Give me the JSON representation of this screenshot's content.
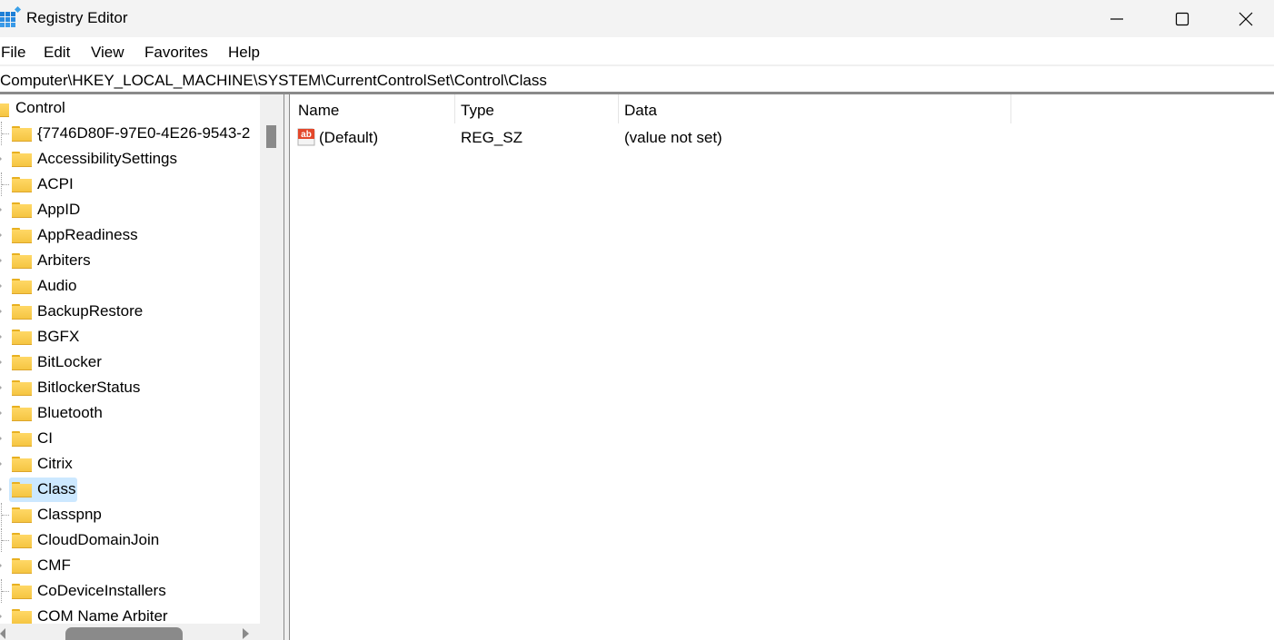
{
  "window": {
    "title": "Registry Editor",
    "controls": [
      "minimize",
      "maximize",
      "close"
    ]
  },
  "menu": {
    "items": [
      "File",
      "Edit",
      "View",
      "Favorites",
      "Help"
    ]
  },
  "address_bar": {
    "path": "Computer\\HKEY_LOCAL_MACHINE\\SYSTEM\\CurrentControlSet\\Control\\Class"
  },
  "tree": {
    "parent": "Control",
    "selected": "Class",
    "items": [
      {
        "label": "{7746D80F-97E0-4E26-9543-2",
        "expandable": false
      },
      {
        "label": "AccessibilitySettings",
        "expandable": true
      },
      {
        "label": "ACPI",
        "expandable": false
      },
      {
        "label": "AppID",
        "expandable": true
      },
      {
        "label": "AppReadiness",
        "expandable": true
      },
      {
        "label": "Arbiters",
        "expandable": true
      },
      {
        "label": "Audio",
        "expandable": true
      },
      {
        "label": "BackupRestore",
        "expandable": true
      },
      {
        "label": "BGFX",
        "expandable": true
      },
      {
        "label": "BitLocker",
        "expandable": true
      },
      {
        "label": "BitlockerStatus",
        "expandable": true
      },
      {
        "label": "Bluetooth",
        "expandable": true
      },
      {
        "label": "CI",
        "expandable": true
      },
      {
        "label": "Citrix",
        "expandable": true
      },
      {
        "label": "Class",
        "expandable": true
      },
      {
        "label": "Classpnp",
        "expandable": false
      },
      {
        "label": "CloudDomainJoin",
        "expandable": false
      },
      {
        "label": "CMF",
        "expandable": true
      },
      {
        "label": "CoDeviceInstallers",
        "expandable": false
      },
      {
        "label": "COM Name Arbiter",
        "expandable": true
      }
    ]
  },
  "values_list": {
    "columns": [
      "Name",
      "Type",
      "Data"
    ],
    "rows": [
      {
        "icon": "string-value-icon",
        "name": "(Default)",
        "type": "REG_SZ",
        "data": "(value not set)"
      }
    ]
  },
  "colors": {
    "selection": "#cce8ff",
    "folder": "#f5c542",
    "scrollbar_thumb": "#8a8a8a"
  }
}
